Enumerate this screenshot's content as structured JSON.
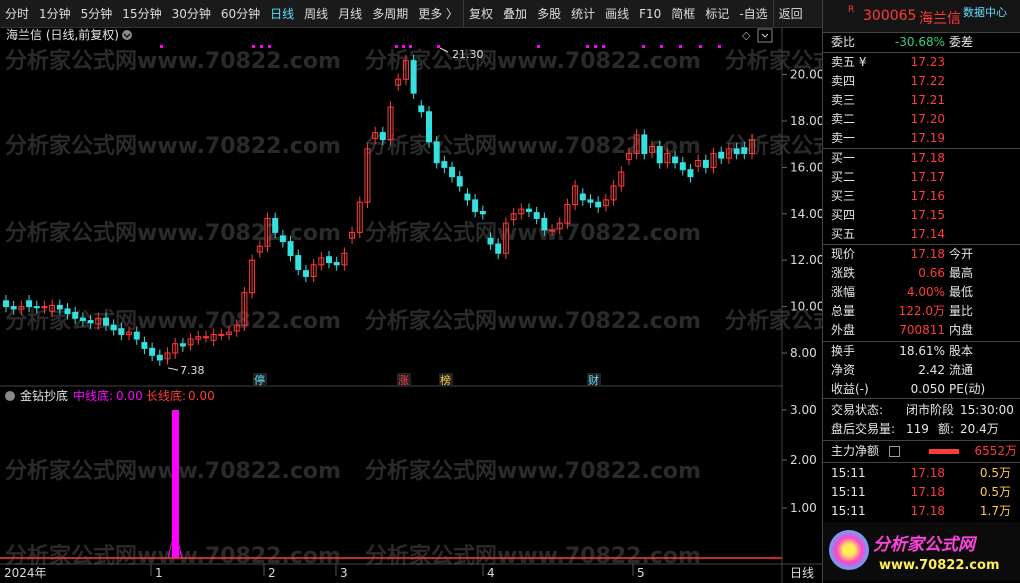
{
  "toolbar": {
    "items": [
      "分时",
      "1分钟",
      "5分钟",
      "15分钟",
      "30分钟",
      "60分钟",
      "日线",
      "周线",
      "月线",
      "多周期",
      "更多 〉",
      "复权",
      "叠加",
      "多股",
      "统计",
      "画线",
      "F10",
      "简框",
      "标记",
      "-自选",
      "返回"
    ],
    "active": "日线"
  },
  "stock": {
    "title": "海兰信 (日线,前复权)",
    "code": "300065",
    "name": "海兰信",
    "flag": "R",
    "data_center": "数据中心"
  },
  "price_axis": [
    "20.00",
    "18.00",
    "16.00",
    "14.00",
    "12.00",
    "10.00",
    "8.00"
  ],
  "ind_axis": [
    "3.00",
    "2.00",
    "1.00"
  ],
  "annotations": {
    "high": "21.30",
    "low": "7.38"
  },
  "event_tags": [
    "停",
    "涨",
    "榜",
    "财"
  ],
  "indicator": {
    "name": "金钻抄底",
    "mid_label": "中线底:",
    "mid_value": "0.00",
    "long_label": "长线底:",
    "long_value": "0.00"
  },
  "time_axis": [
    "2024年",
    "1",
    "2",
    "3",
    "4",
    "5",
    "日线"
  ],
  "watermark": "分析家公式网www.70822.com",
  "logo": {
    "cn": "分析家公式网",
    "url": "www.70822.com"
  },
  "order_book": {
    "weibi_label": "委比",
    "weibi": "-30.68%",
    "weicha_label": "委差",
    "asks": [
      {
        "label": "卖五 ¥",
        "price": "17.23"
      },
      {
        "label": "卖四",
        "price": "17.22"
      },
      {
        "label": "卖三",
        "price": "17.21"
      },
      {
        "label": "卖二",
        "price": "17.20"
      },
      {
        "label": "卖一",
        "price": "17.19"
      }
    ],
    "bids": [
      {
        "label": "买一",
        "price": "17.18"
      },
      {
        "label": "买二",
        "price": "17.17"
      },
      {
        "label": "买三",
        "price": "17.16"
      },
      {
        "label": "买四",
        "price": "17.15"
      },
      {
        "label": "买五",
        "price": "17.14"
      }
    ]
  },
  "quote": [
    {
      "l": "现价",
      "v": "17.18",
      "r": "今开"
    },
    {
      "l": "涨跌",
      "v": "0.66",
      "r": "最高"
    },
    {
      "l": "涨幅",
      "v": "4.00%",
      "r": "最低"
    },
    {
      "l": "总量",
      "v": "122.0万",
      "r": "量比"
    },
    {
      "l": "外盘",
      "v": "700811",
      "r": "内盘"
    }
  ],
  "stats": [
    {
      "l": "换手",
      "v": "18.61%",
      "r": "股本"
    },
    {
      "l": "净资",
      "v": "2.42",
      "r": "流通"
    },
    {
      "l": "收益(-)",
      "v": "0.050",
      "r": "PE(动)"
    }
  ],
  "trade_status": {
    "label": "交易状态:",
    "status": "闭市阶段",
    "time": "15:30:00"
  },
  "after_hours": {
    "label": "盘后交易量:",
    "vol": "119",
    "amt_label": "额:",
    "amt": "20.4万"
  },
  "main_flow": {
    "label": "主力净额",
    "value": "6552万"
  },
  "ticks": [
    {
      "t": "15:11",
      "p": "17.18",
      "v": "0.5万"
    },
    {
      "t": "15:11",
      "p": "17.18",
      "v": "0.5万"
    },
    {
      "t": "15:11",
      "p": "17.18",
      "v": "1.7万"
    }
  ],
  "colors": {
    "up": "#ff3b3b",
    "down": "#34e0e0",
    "magenta": "#ff00ff",
    "cyan": "#5ee0ff"
  }
}
